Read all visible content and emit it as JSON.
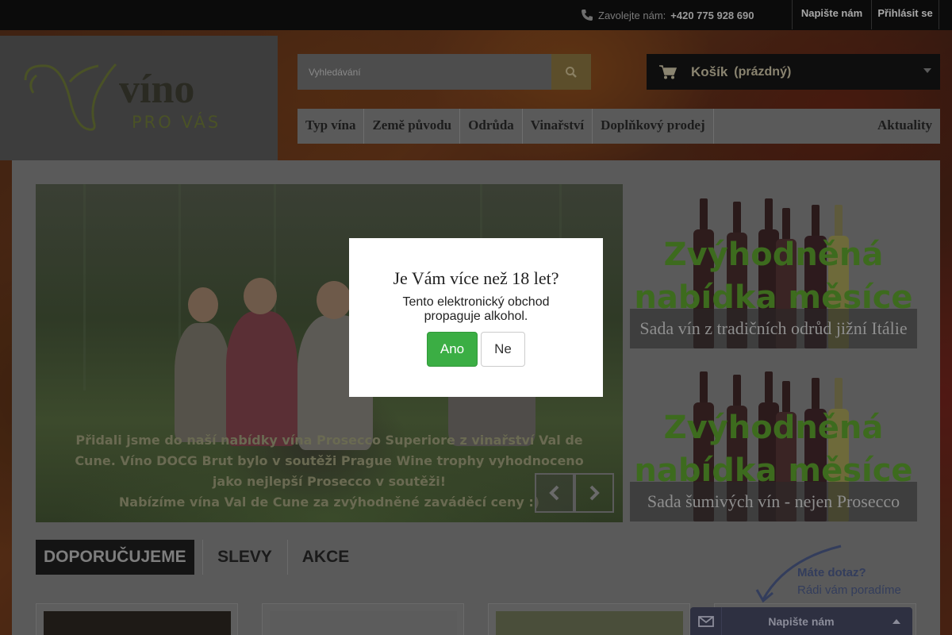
{
  "topbar": {
    "phone_label": "Zavolejte nám:",
    "phone_number": "+420 775 928 690",
    "write_us": "Napište nám",
    "login": "Přihlásit se"
  },
  "logo": {
    "word": "víno",
    "sub": "PRO VÁS"
  },
  "search": {
    "placeholder": "Vyhledávání"
  },
  "cart": {
    "title": "Košík",
    "status": "(prázdný)"
  },
  "nav": {
    "items": [
      "Typ vína",
      "Země původu",
      "Odrůda",
      "Vinařství",
      "Doplňkový prodej"
    ],
    "right": "Aktuality"
  },
  "slider": {
    "caption": [
      "Přidali jsme do naší nabídky vína Prosecco Superiore z vinařství Val de",
      "Cune. Víno DOCG Brut bylo v soutěži Prague Wine trophy vyhodnoceno",
      "jako nejlepší Prosecco v soutěži!",
      "Nabízíme vína Val de Cune za zvýhodněné zaváděcí ceny :)"
    ]
  },
  "promos": [
    {
      "headline_1": "Zvýhodněná",
      "headline_2": "nabídka měsíce",
      "caption": "Sada vín z tradičních odrůd jižní Itálie"
    },
    {
      "headline_1": "Zvýhodněná",
      "headline_2": "nabídka měsíce",
      "caption": "Sada šumivých vín - nejen Prosecco"
    }
  ],
  "tabs": {
    "recommended": "DOPORUČUJEME",
    "discounts": "SLEVY",
    "promotions": "AKCE"
  },
  "ask": {
    "title": "Máte dotaz?",
    "subtitle": "Rádi vám poradíme"
  },
  "chat": {
    "label": "Napište nám"
  },
  "age_modal": {
    "title": "Je Vám více než 18 let?",
    "text": "Tento elektronický obchod propaguje alkohol.",
    "yes": "Ano",
    "no": "Ne"
  },
  "colors": {
    "accent_green": "#3bae44",
    "cart_bg": "#0e0e0e",
    "chat_bg": "#2e3041"
  }
}
